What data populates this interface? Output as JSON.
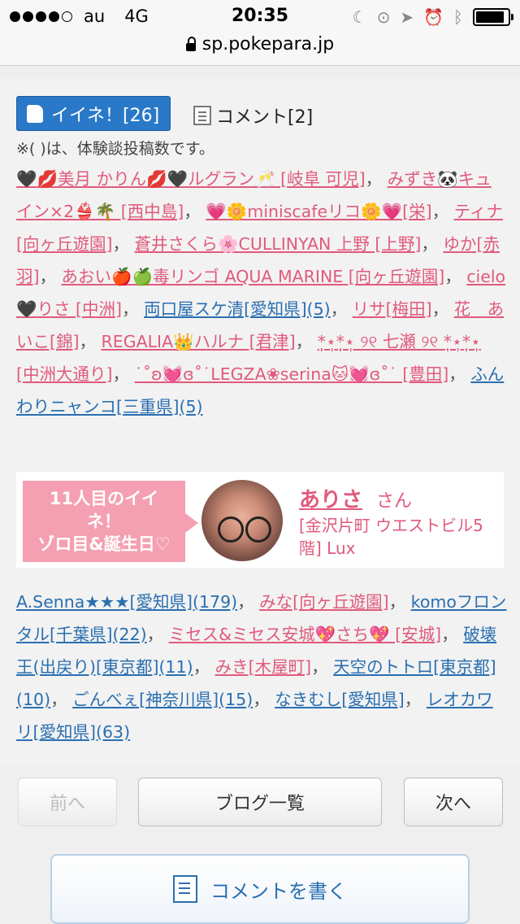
{
  "status_bar": {
    "carrier": "au",
    "network": "4G",
    "time": "20:35"
  },
  "url_bar": {
    "url": "sp.pokepara.jp"
  },
  "like": {
    "label": "イイネ！[26]"
  },
  "comment": {
    "label": "コメント[2]"
  },
  "note": "※( )は、体験談投稿数です。",
  "names1": [
    {
      "text": "🖤💋美月 かりん💋🖤ルグラン🥂 [岐阜 可児]",
      "color": "pink"
    },
    {
      "text": "みずき🐼キュイン×2👙🌴 [西中島]",
      "color": "pink"
    },
    {
      "text": "💗🌼miniscafeリコ🌼💗[栄]",
      "color": "pink"
    },
    {
      "text": "ティナ[向ヶ丘遊園]",
      "color": "pink"
    },
    {
      "text": "蒼井さくら🌸CULLINYAN 上野 [上野]",
      "color": "pink"
    },
    {
      "text": "ゆか[赤羽]",
      "color": "pink"
    },
    {
      "text": "あおい🍎🍏毒リンゴ AQUA MARINE [向ヶ丘遊園]",
      "color": "pink"
    },
    {
      "text": "cielo🖤りさ [中洲]",
      "color": "pink"
    },
    {
      "text": "両口屋スケ清[愛知県](5)",
      "color": "blue"
    },
    {
      "text": "リサ[梅田]",
      "color": "pink"
    },
    {
      "text": "花　あいこ[錦]",
      "color": "pink"
    },
    {
      "text": "REGALIA👑ハルナ [君津]",
      "color": "pink"
    },
    {
      "text": "*̣̩⋆̩*̣̩⋆̩ ୨୧ 七瀬 ୨୧ *̣̩⋆̩*̣̩⋆̩ [中洲大通り]",
      "color": "pink"
    },
    {
      "text": "˙˚ʚ💓ɞ˚˙LEGZA❀serina🐱💓ɞ˚˙ [豊田]",
      "color": "pink"
    },
    {
      "text": "ふんわりニャンコ[三重県](5)",
      "color": "blue"
    }
  ],
  "card": {
    "ribbon_line1": "11人目のイイ",
    "ribbon_line2": "ネ！",
    "ribbon_line3": "ゾロ目&誕生日♡",
    "name": "ありさ",
    "honorific": "さん",
    "place": "[金沢片町 ウエストビル5階] Lux"
  },
  "names2": [
    {
      "text": "A.Senna★★★[愛知県](179)",
      "color": "blue"
    },
    {
      "text": "みな[向ヶ丘遊園]",
      "color": "pink"
    },
    {
      "text": "komoフロンタル[千葉県](22)",
      "color": "blue"
    },
    {
      "text": "ミセス&ミセス安城💖さち💖 [安城]",
      "color": "pink"
    },
    {
      "text": "破壊王(出戻り)[東京都](11)",
      "color": "blue"
    },
    {
      "text": "みき[木屋町]",
      "color": "pink"
    },
    {
      "text": "天空のトトロ[東京都](10)",
      "color": "blue"
    },
    {
      "text": "ごんべぇ[神奈川県](15)",
      "color": "blue"
    },
    {
      "text": "なきむし[愛知県]",
      "color": "blue"
    },
    {
      "text": "レオカワリ[愛知県](63)",
      "color": "blue"
    }
  ],
  "pager": {
    "prev": "前へ",
    "list": "ブログ一覧",
    "next": "次へ"
  },
  "write_comment": "コメントを書く",
  "colors": {
    "pink": "#e05a7c",
    "blue": "#2a6fb0",
    "like_button": "#2a78c8",
    "ribbon": "#f4a0b2"
  }
}
